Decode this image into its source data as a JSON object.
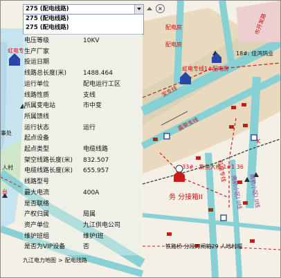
{
  "dropdown": {
    "selected": "275 (配电线路)",
    "options": [
      "275 (配电线路)",
      "275 (配电线路)"
    ]
  },
  "properties": [
    {
      "key": "电压等级",
      "value": "10KV"
    },
    {
      "key": "生产厂家",
      "value": ""
    },
    {
      "key": "投运日期",
      "value": ""
    },
    {
      "key": "线路总长度(米)",
      "value": "1488.464"
    },
    {
      "key": "运行单位",
      "value": "配电运行工区"
    },
    {
      "key": "线路性质",
      "value": "支线"
    },
    {
      "key": "所属变电站",
      "value": "市中变"
    },
    {
      "key": "所属馈线",
      "value": ""
    },
    {
      "key": "运行状态",
      "value": "运行"
    },
    {
      "key": "起点设备",
      "value": ""
    },
    {
      "key": "起点类型",
      "value": "电缆线路"
    },
    {
      "key": "架空线路长度(米)",
      "value": "832.507"
    },
    {
      "key": "电缆线路长度(米)",
      "value": "655.957"
    },
    {
      "key": "线路型号",
      "value": ""
    },
    {
      "key": "最大电流",
      "value": "400A"
    },
    {
      "key": "是否联络",
      "value": ""
    },
    {
      "key": "产权归属",
      "value": "局属"
    },
    {
      "key": "资产单位",
      "value": "九江供电公司"
    },
    {
      "key": "维护班组",
      "value": "维护I班"
    },
    {
      "key": "是否为VIP设备",
      "value": "否"
    }
  ],
  "status": {
    "crumb1": "九江电力地图",
    "sep": ">",
    "crumb2": "配电线路"
  },
  "map_labels": {
    "hongdian_station": "虹电专线1#配电房",
    "hongdian_left": "虹电专",
    "company": "18#: 佳鸿钨业",
    "peidian1": "配电房",
    "peidian2": "配电房",
    "shichuanglu": "市开发路",
    "jiyubei": "集鱼北",
    "baozhixian": "宝支线",
    "jiamenzhi": "嘉荣支线",
    "dalou": "33# : 集鱼大楼 1#1 36",
    "fen": "务 分接箱II",
    "shijian": "事处",
    "rencun": "人村",
    "taifeng": "台",
    "bottom": "铁路桥 分段刀闸箱29 人地村幅",
    "xiaoqu": "南航小区I II线",
    "hongdian_line": "虹电专线",
    "jiaodian": "南航小区I II线",
    "k": "K"
  }
}
